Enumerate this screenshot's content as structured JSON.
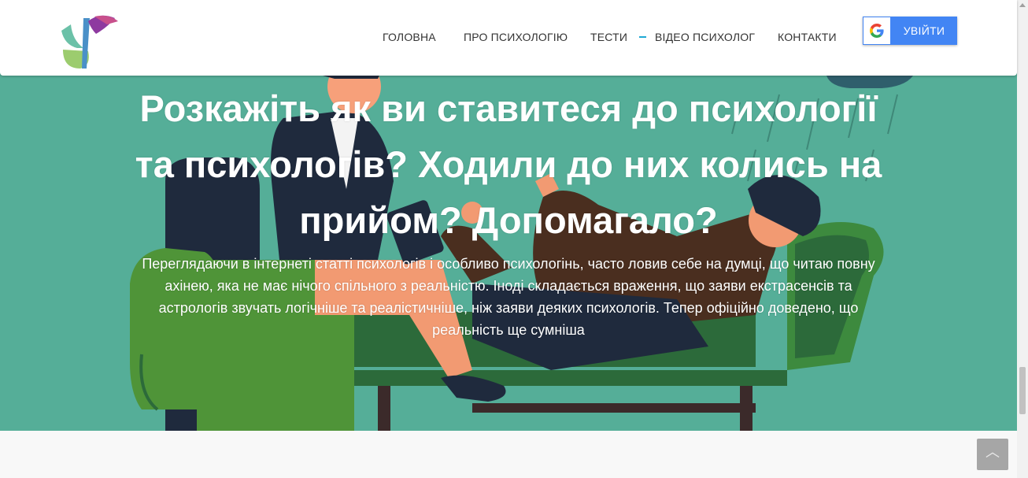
{
  "nav": {
    "items": [
      "ГОЛОВНА",
      "ПРО ПСИХОЛОГІЮ",
      "ТЕСТИ",
      "ВІДЕО ПСИХОЛОГ",
      "КОНТАКТИ"
    ],
    "active_marker_color": "#1fa9d4"
  },
  "login": {
    "label": "УВІЙТИ",
    "icon": "google-g-icon"
  },
  "hero": {
    "title": "Розкажіть як ви ставитеся до психології та психологів? Ходили до них колись на прийом? Допомагало?",
    "text": "Переглядаючи в інтернеті статті психологів і особливо психологінь, часто ловив себе на думці, що читаю повну ахінею, яка не має нічого спільного з реальністю. Іноді складається враження, що заяви екстрасенсів та астрологів звучать логічніше та реалістичніше, ніж заяви деяких психологів. Тепер офіційно доведено, що реальність ще сумніша",
    "background_color": "#55ae98"
  },
  "scroll_top": {
    "icon": "chevron-up-icon"
  }
}
